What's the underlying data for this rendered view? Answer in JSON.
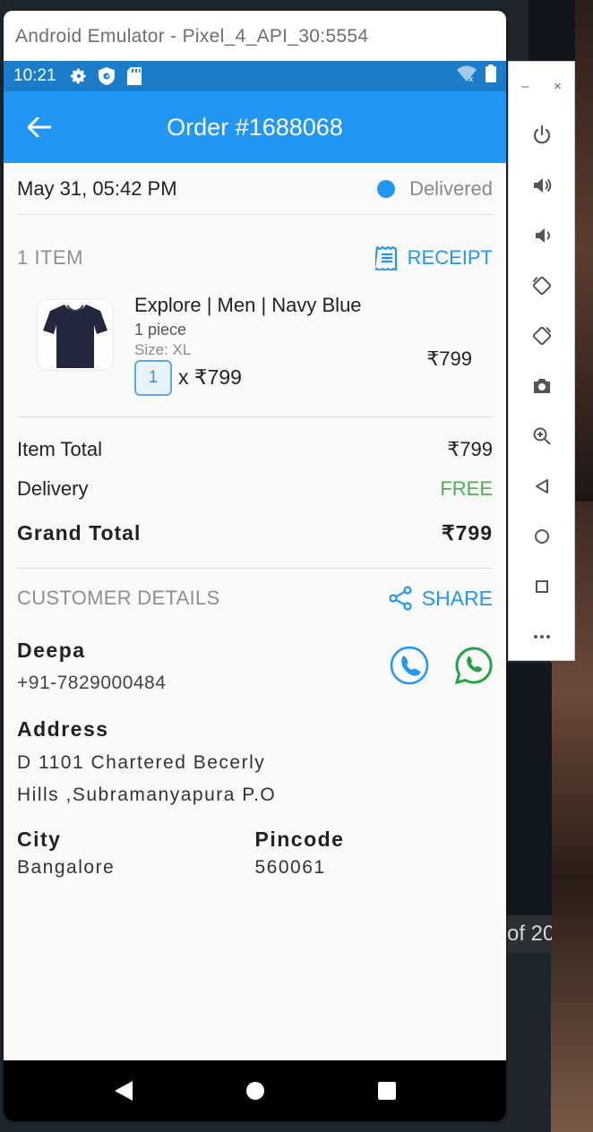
{
  "emulator": {
    "window_title": "Android Emulator - Pixel_4_API_30:5554",
    "sidebar_minimize": "–",
    "sidebar_close": "×"
  },
  "desktop": {
    "partial_text": "of 20"
  },
  "status_bar": {
    "time": "10:21"
  },
  "app_bar": {
    "title": "Order #1688068"
  },
  "order": {
    "date": "May 31, 05:42 PM",
    "status": "Delivered",
    "status_color": "#2196f3",
    "items_count": "1 ITEM",
    "receipt_label": "RECEIPT"
  },
  "product": {
    "name": "Explore | Men | Navy Blue",
    "piece": "1 piece",
    "size": "Size: XL",
    "quantity": "1",
    "unit_price": "x ₹799",
    "line_total": "₹799"
  },
  "totals": {
    "item_total_label": "Item Total",
    "item_total_value": "₹799",
    "delivery_label": "Delivery",
    "delivery_value": "FREE",
    "grand_total_label": "Grand Total",
    "grand_total_value": "₹799"
  },
  "customer": {
    "section_title": "CUSTOMER DETAILS",
    "share_label": "SHARE",
    "name": "Deepa",
    "phone": "+91-7829000484",
    "address_label": "Address",
    "address_line1": "D 1101 Chartered Becerly",
    "address_line2": "Hills ,Subramanyapura P.O",
    "city_label": "City",
    "city_value": "Bangalore",
    "pincode_label": "Pincode",
    "pincode_value": "560061"
  },
  "colors": {
    "primary": "#2196f3",
    "status_bar": "#1b7cc9",
    "free": "#4caf50",
    "whatsapp": "#25a244"
  }
}
